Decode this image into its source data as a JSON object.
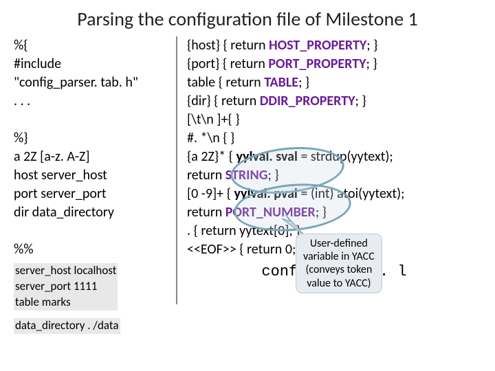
{
  "title": "Parsing the configuration file of Milestone 1",
  "left": {
    "l1": "%{",
    "l2": "#include",
    "l3": "  \"config_parser. tab. h\"",
    "l4": ". . .",
    "l5": "%}",
    "l6": "a 2Z  [a-z. A-Z]",
    "l7": "host server_host",
    "l8": "port server_port",
    "l9": "dir   data_directory",
    "l10": "%%",
    "cfg1": "server_host localhost",
    "cfg2": "server_port 1111",
    "cfg3": "table marks",
    "cfg4": "data_directory . /data"
  },
  "right": {
    "r1a": "{host}   { return ",
    "r1b": "HOST_PROPERTY",
    "r1c": "; }",
    "r2a": "{port}   { return ",
    "r2b": "PORT_PROPERTY",
    "r2c": "; }",
    "r3a": "table     { return ",
    "r3b": "TABLE",
    "r3c": "; }",
    "r4a": "{dir}     { return ",
    "r4b": "DDIR_PROPERTY",
    "r4c": "; }",
    "r5": "[\\t\\n ]+{              }",
    "r6": "#. *\\n   {              }",
    "r7a": "{a 2Z}* { ",
    "r7b": "yylval. sval",
    "r7c": " = strdup(yytext);",
    "r8a": "              return ",
    "r8b": "STRING",
    "r8c": "; }",
    "r9a": "[0 -9]+   { ",
    "r9b": "yylval. pval",
    "r9c": " = (int) atoi(yytext);",
    "r10a": "              return ",
    "r10b": "PORT_NUMBER",
    "r10c": "; }",
    "r11": ".             { return yytext[0]; }",
    "r12": "<<EOF>> { return 0; }",
    "fname": "config_parser. l"
  },
  "callout": {
    "l1": "User-defined",
    "l2": "variable in YACC",
    "l3": "(conveys token",
    "l4": "value to YACC)"
  }
}
